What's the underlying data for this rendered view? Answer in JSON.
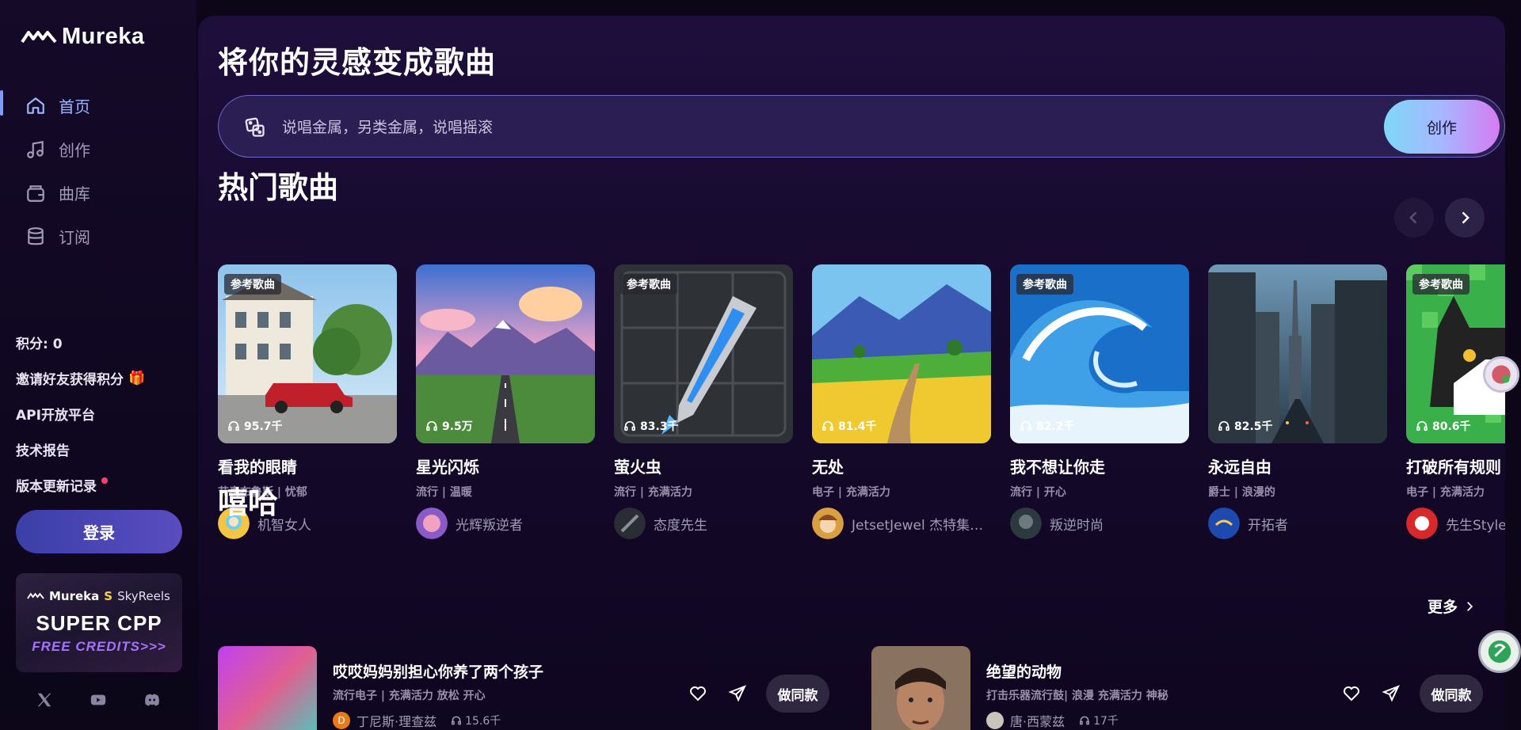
{
  "app": {
    "name": "Mureka"
  },
  "nav": [
    {
      "label": "首页",
      "active": true,
      "icon": "home-icon"
    },
    {
      "label": "创作",
      "active": false,
      "icon": "music-note-icon"
    },
    {
      "label": "曲库",
      "active": false,
      "icon": "library-icon"
    },
    {
      "label": "订阅",
      "active": false,
      "icon": "database-icon"
    }
  ],
  "side_links": {
    "points": "积分: 0",
    "invite": "邀请好友获得积分",
    "api": "API开放平台",
    "tech_report": "技术报告",
    "changelog": "版本更新记录"
  },
  "login_label": "登录",
  "promo": {
    "brand_a": "Mureka",
    "brand_b": "SkyReels",
    "headline": "SUPER CPP",
    "subline": "FREE CREDITS>>>"
  },
  "hero": {
    "title": "将你的灵感变成歌曲",
    "placeholder": "说唱金属，另类金属，说唱摇滚",
    "create_label": "创作"
  },
  "hot": {
    "title": "热门歌曲",
    "songs": [
      {
        "title": "看我的眼睛",
        "tags": "节奏布鲁斯 | 忧郁",
        "artist": "机智女人",
        "plays": "95.7千",
        "ref": "参考歌曲"
      },
      {
        "title": "星光闪烁",
        "tags": "流行 | 温暖",
        "artist": "光辉叛逆者",
        "plays": "9.5万",
        "ref": ""
      },
      {
        "title": "萤火虫",
        "tags": "流行 | 充满活力",
        "artist": "态度先生",
        "plays": "83.3千",
        "ref": "参考歌曲"
      },
      {
        "title": "无处",
        "tags": "电子 | 充满活力",
        "artist": "JetsetJewel  杰特集…",
        "plays": "81.4千",
        "ref": ""
      },
      {
        "title": "我不想让你走",
        "tags": "流行 | 开心",
        "artist": "叛逆时尚",
        "plays": "82.2千",
        "ref": "参考歌曲"
      },
      {
        "title": "永远自由",
        "tags": "爵士 | 浪漫的",
        "artist": "开拓者",
        "plays": "82.5千",
        "ref": ""
      },
      {
        "title": "打破所有规则",
        "tags": "电子 | 充满活力",
        "artist": "先生Style",
        "plays": "80.6千",
        "ref": "参考歌曲"
      }
    ]
  },
  "hiphop": {
    "title": "嘻哈",
    "more_label": "更多",
    "items": [
      {
        "title": "哎哎妈妈别担心你养了两个孩子",
        "tags": "流行电子 | 充满活力 放松 开心",
        "artist": "丁尼斯·理查兹",
        "avatar_letter": "D",
        "plays": "15.6千",
        "same_label": "做同款"
      },
      {
        "title": "绝望的动物",
        "tags": "打击乐器流行鼓| 浪漫 充满活力 神秘",
        "artist": "唐·西蒙兹",
        "avatar_letter": "",
        "plays": "17千",
        "same_label": "做同款"
      }
    ]
  },
  "colors": {
    "accent": "#9db7ff",
    "background": "#0d0618",
    "create_gradient": [
      "#7fd8f7",
      "#d57cf2"
    ]
  }
}
